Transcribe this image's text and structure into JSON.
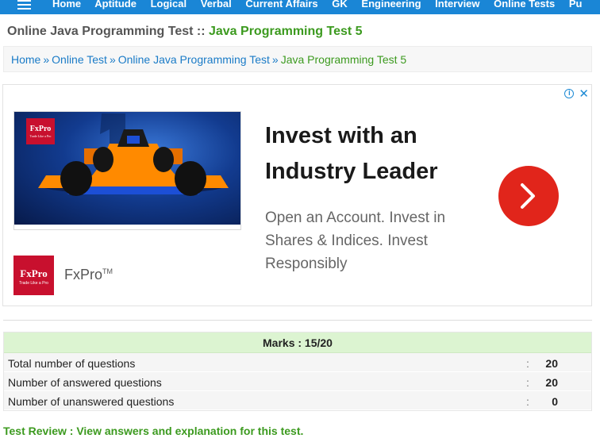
{
  "nav": {
    "items": [
      "Home",
      "Aptitude",
      "Logical",
      "Verbal",
      "Current Affairs",
      "GK",
      "Engineering",
      "Interview",
      "Online Tests",
      "Pu"
    ]
  },
  "title": {
    "prefix": "Online Java Programming Test :: ",
    "highlight": "Java Programming Test 5"
  },
  "breadcrumb": {
    "items": [
      "Home",
      "Online Test",
      "Online Java Programming Test"
    ],
    "separator": "»",
    "current": "Java Programming Test 5"
  },
  "ad": {
    "image_logo": "FxPro",
    "image_logo_tagline": "Trade Like a Pro",
    "headline": "Invest with an Industry Leader",
    "body": "Open an Account. Invest in Shares & Indices. Invest Responsibly",
    "logo": "FxPro",
    "logo_tagline": "Trade Like a Pro",
    "brand": "FxPro",
    "brand_mark": "TM",
    "info_icon": "info-icon",
    "close_icon": "close-icon",
    "cta_icon": "chevron-right-icon",
    "cta_color": "#e1251b"
  },
  "result": {
    "marks": "Marks : 15/20",
    "rows": [
      {
        "label": "Total number of questions",
        "colon": ":",
        "value": "20"
      },
      {
        "label": "Number of answered questions",
        "colon": ":",
        "value": "20"
      },
      {
        "label": "Number of unanswered questions",
        "colon": ":",
        "value": "0"
      }
    ]
  },
  "review": {
    "text": "Test Review : View answers and explanation for this test."
  },
  "colors": {
    "nav_bg": "#1a86d6",
    "accent_green": "#3c9a1f",
    "link_blue": "#1a7bc7",
    "marks_bg": "#dcf4d1"
  }
}
